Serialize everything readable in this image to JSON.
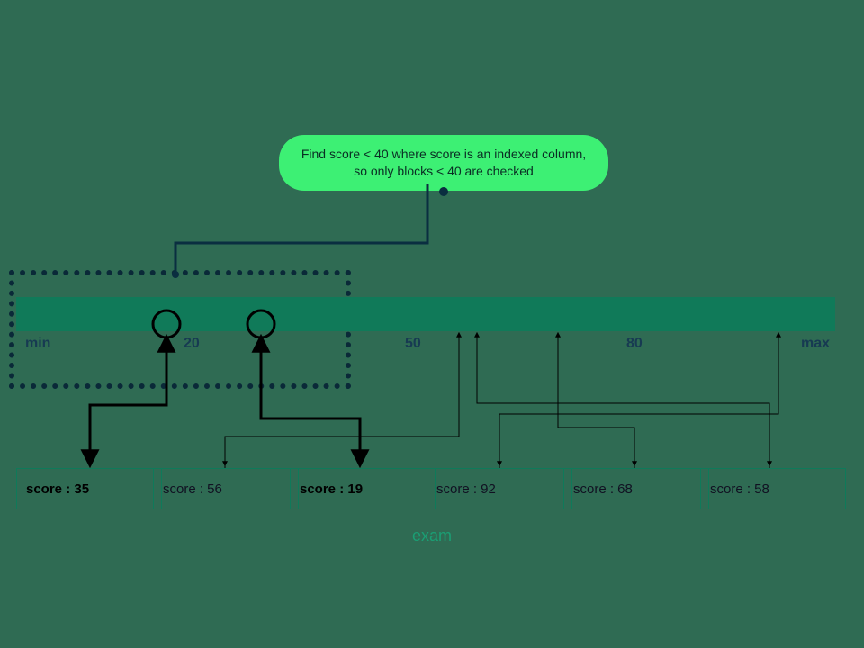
{
  "badge_text": "Find score < 40 where score is an indexed column, so only blocks < 40 are checked",
  "ticks": {
    "min": "min",
    "t20": "20",
    "t50": "50",
    "t80": "80",
    "max": "max"
  },
  "cells": {
    "c0": "score : 35",
    "c1": "score : 56",
    "c2": "score : 19",
    "c3": "score : 92",
    "c4": "score : 68",
    "c5": "score : 58"
  },
  "caption": "exam"
}
